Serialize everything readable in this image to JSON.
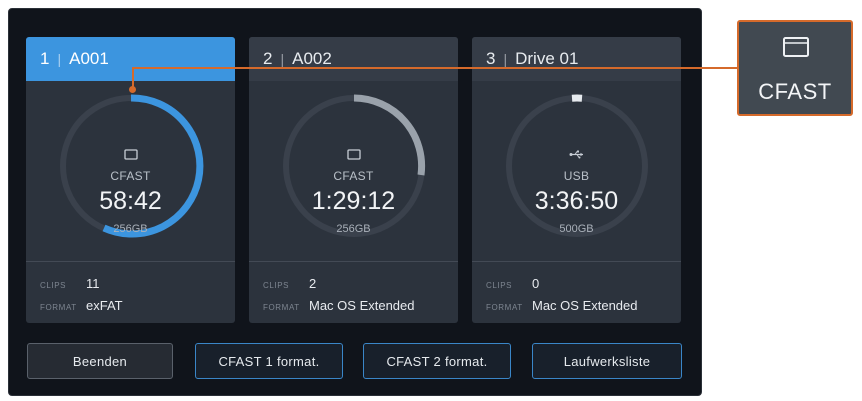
{
  "slots": [
    {
      "number": "1",
      "name": "A001",
      "media_type": "CFAST",
      "media_icon": "cfast-card-icon",
      "time_remaining": "58:42",
      "capacity": "256GB",
      "clips_label": "CLIPS",
      "clips": "11",
      "format_label": "FORMAT",
      "format": "exFAT",
      "active": true,
      "accent": "#3c95df"
    },
    {
      "number": "2",
      "name": "A002",
      "media_type": "CFAST",
      "media_icon": "cfast-card-icon",
      "time_remaining": "1:29:12",
      "capacity": "256GB",
      "clips_label": "CLIPS",
      "clips": "2",
      "format_label": "FORMAT",
      "format": "Mac OS Extended",
      "active": false,
      "accent": "#9aa2ab"
    },
    {
      "number": "3",
      "name": "Drive 01",
      "media_type": "USB",
      "media_icon": "usb-icon",
      "time_remaining": "3:36:50",
      "capacity": "500GB",
      "clips_label": "CLIPS",
      "clips": "0",
      "format_label": "FORMAT",
      "format": "Mac OS Extended",
      "active": false,
      "accent": "#e6eaee"
    }
  ],
  "separator": "|",
  "buttons": {
    "exit": "Beenden",
    "format_cfast1": "CFAST 1 format.",
    "format_cfast2": "CFAST 2 format.",
    "drive_list": "Laufwerksliste"
  },
  "callout": {
    "label": "CFAST",
    "icon": "cfast-card-icon",
    "color": "#d56a2b"
  }
}
